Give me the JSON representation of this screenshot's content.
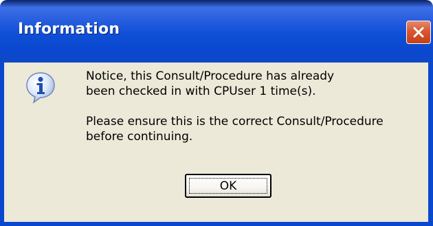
{
  "window": {
    "title": "Information",
    "close_icon": "close-icon"
  },
  "message": {
    "icon": "info-icon",
    "line1": "Notice, this Consult/Procedure has already",
    "line2": "been checked in with CPUser 1 time(s).",
    "line3": "Please ensure this is the correct Consult/Procedure",
    "line4": "before continuing."
  },
  "buttons": {
    "ok_label": "OK"
  },
  "colors": {
    "titlebar": "#0a47cf",
    "client_bg": "#ece9d8",
    "close_bg": "#d9572f",
    "title_text": "#ffffff"
  }
}
